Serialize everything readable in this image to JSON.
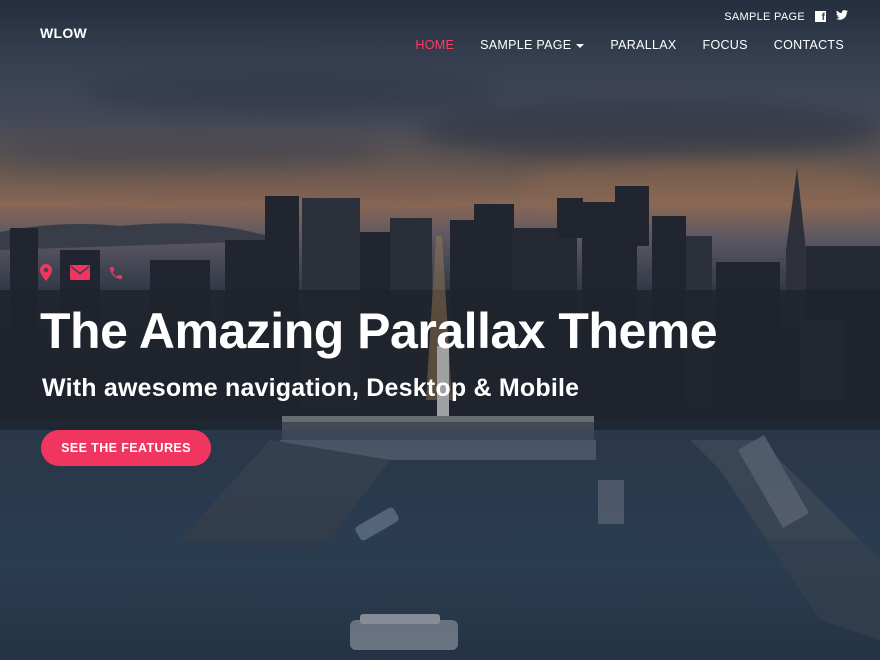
{
  "brand": {
    "logo": "WLOW"
  },
  "topbar": {
    "link": "SAMPLE PAGE",
    "social": [
      "facebook-icon",
      "twitter-icon"
    ]
  },
  "nav": {
    "items": [
      {
        "label": "HOME",
        "active": true
      },
      {
        "label": "SAMPLE PAGE",
        "dropdown": true
      },
      {
        "label": "PARALLAX"
      },
      {
        "label": "FOCUS"
      },
      {
        "label": "CONTACTS"
      }
    ]
  },
  "hero": {
    "icons": [
      "location-pin-icon",
      "envelope-icon",
      "phone-icon"
    ],
    "title": "The Amazing Parallax Theme",
    "subtitle": "With awesome navigation, Desktop & Mobile",
    "cta_label": "SEE THE FEATURES"
  },
  "colors": {
    "accent": "#f0365f",
    "active_nav": "#ff3a67",
    "text": "#ffffff"
  }
}
